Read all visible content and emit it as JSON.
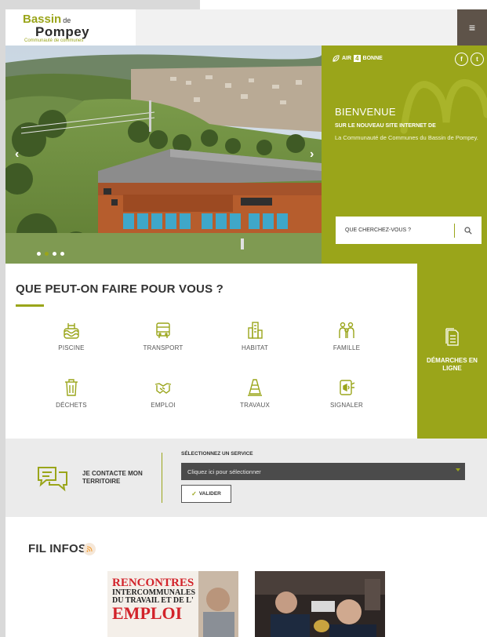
{
  "header": {
    "logo": {
      "line1": "Bassin",
      "line1_small": "de",
      "line2": "Pompey",
      "tagline": "Communauté de communes"
    },
    "menu_glyph": "≡"
  },
  "hero": {
    "prev_arrow": "‹",
    "next_arrow": "›",
    "air_quality": {
      "prefix": "AIR",
      "value": "4",
      "status": "BONNE"
    },
    "social": {
      "facebook": "f",
      "twitter": "t"
    },
    "welcome_title": "BIENVENUE",
    "welcome_subtitle": "SUR LE NOUVEAU SITE INTERNET DE",
    "welcome_text": "La Communauté de Communes du Bassin de Pompey.",
    "search_label": "QUE CHERCHEZ-VOUS ?"
  },
  "services": {
    "title_plain": "QUE PEUT-ON ",
    "title_bold": "FAIRE POUR VOUS ?",
    "items": [
      {
        "label": "PISCINE",
        "icon": "swimming-pool-icon"
      },
      {
        "label": "TRANSPORT",
        "icon": "bus-icon"
      },
      {
        "label": "HABITAT",
        "icon": "buildings-icon"
      },
      {
        "label": "FAMILLE",
        "icon": "family-icon"
      },
      {
        "label": "DÉCHETS",
        "icon": "trash-icon"
      },
      {
        "label": "EMPLOI",
        "icon": "handshake-icon"
      },
      {
        "label": "TRAVAUX",
        "icon": "traffic-cone-icon"
      },
      {
        "label": "SIGNALER",
        "icon": "megaphone-icon"
      }
    ]
  },
  "demarches": {
    "label": "DÉMARCHES EN LIGNE",
    "icon": "document-icon"
  },
  "contact": {
    "label": "JE CONTACTE MON TERRITOIRE",
    "select_title": "SÉLECTIONNEZ UN SERVICE",
    "select_value": "Cliquez ici pour sélectionner",
    "validate_label": "VALIDER"
  },
  "news": {
    "title": "FIL INFOS",
    "card1": {
      "lines": [
        "RENCONTRES",
        "INTERCOMMUNALES",
        "DU TRAVAIL ET DE L'",
        "EMPLOI"
      ]
    }
  },
  "colors": {
    "accent": "#9aa51a",
    "menu": "#5e5349",
    "select": "#4b4b4b",
    "contact_bg": "#ebebeb"
  }
}
